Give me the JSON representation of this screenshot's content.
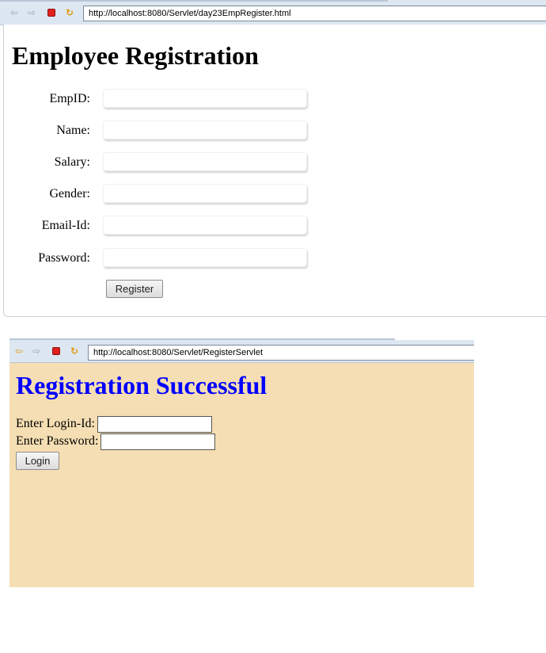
{
  "window1": {
    "address_url": "http://localhost:8080/Servlet/day23EmpRegister.html",
    "heading": "Employee Registration",
    "fields": [
      {
        "label": "EmpID:",
        "value": ""
      },
      {
        "label": "Name:",
        "value": ""
      },
      {
        "label": "Salary:",
        "value": ""
      },
      {
        "label": "Gender:",
        "value": ""
      },
      {
        "label": "Email-Id:",
        "value": ""
      },
      {
        "label": "Password:",
        "value": ""
      }
    ],
    "register_label": "Register"
  },
  "window2": {
    "address_url": "http://localhost:8080/Servlet/RegisterServlet",
    "heading": "Registration Successful",
    "login_id_label": "Enter Login-Id:",
    "password_label": "Enter Password:",
    "login_label": "Login",
    "background_color": "#f5deb3",
    "heading_color": "#0000ff"
  },
  "icons": {
    "back": "back-arrow-icon",
    "forward": "forward-arrow-icon",
    "stop": "stop-icon",
    "refresh": "refresh-icon"
  }
}
